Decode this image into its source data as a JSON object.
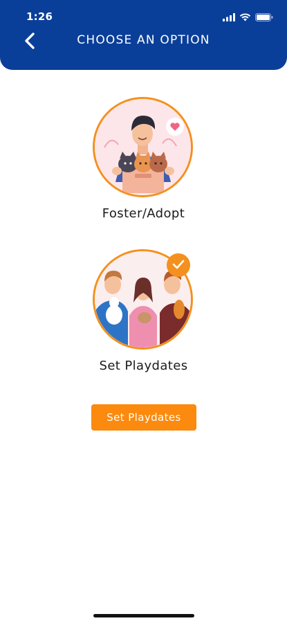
{
  "status_bar": {
    "time": "1:26",
    "icons": [
      "signal-icon",
      "wifi-icon",
      "battery-icon"
    ]
  },
  "header": {
    "title": "CHOOSE AN OPTION",
    "back_icon": "chevron-left-icon",
    "background_color": "#0a3f99"
  },
  "options": [
    {
      "label": "Foster/Adopt",
      "illustration": "man-with-cats-illustration",
      "selected": false
    },
    {
      "label": "Set Playdates",
      "illustration": "kids-with-pets-illustration",
      "selected": true
    }
  ],
  "primary_action": {
    "label": "Set Playdates"
  },
  "colors": {
    "accent": "#f4901e",
    "button": "#fb8a0e",
    "header": "#0a3f99"
  }
}
